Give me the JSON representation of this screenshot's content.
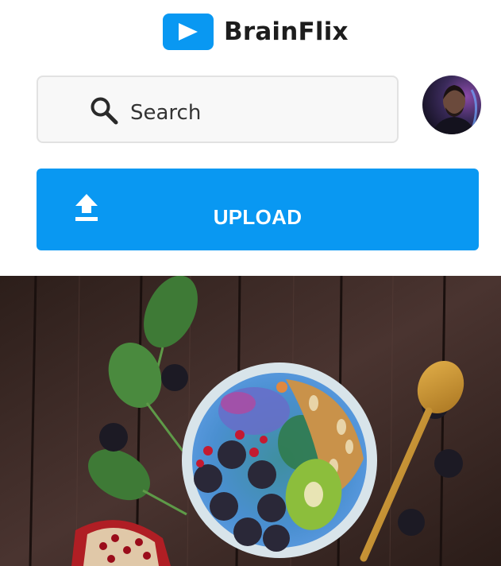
{
  "app": {
    "name": "BrainFlix",
    "brand_color": "#0998f2",
    "logo_icon": "play-icon"
  },
  "search": {
    "placeholder": "Search",
    "icon": "search-icon"
  },
  "profile": {
    "icon": "avatar"
  },
  "upload": {
    "label": "UPLOAD",
    "icon": "upload-icon"
  }
}
